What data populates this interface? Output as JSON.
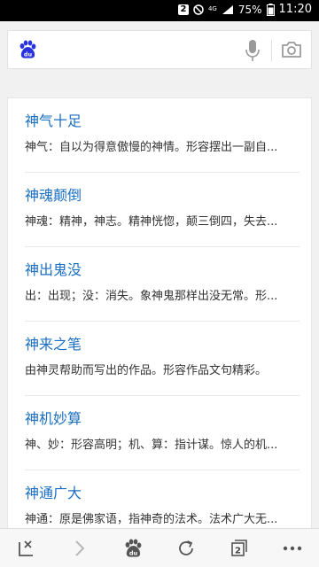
{
  "status_bar": {
    "badge": "2",
    "network": "4G",
    "battery": "75%",
    "time": "11:20"
  },
  "search": {
    "logo_text": "du",
    "value": "",
    "placeholder": ""
  },
  "results": [
    {
      "title": "神气十足",
      "desc": "神气：自以为得意傲慢的神情。形容摆出一副自..."
    },
    {
      "title": "神魂颠倒",
      "desc": "神魂：精神，神志。精神恍惚，颠三倒四，失去..."
    },
    {
      "title": "神出鬼没",
      "desc": "出：出现；没：消失。象神鬼那样出没无常。形..."
    },
    {
      "title": "神来之笔",
      "desc": "由神灵帮助而写出的作品。形容作品文句精彩。"
    },
    {
      "title": "神机妙算",
      "desc": "神、妙：形容高明；机、算：指计谋。惊人的机..."
    },
    {
      "title": "神通广大",
      "desc": "神通：原是佛家语，指神奇的法术。法术广大无..."
    }
  ],
  "toolbar": {
    "tab_count": "2",
    "logo_text": "du"
  },
  "colors": {
    "link": "#1a6fc2",
    "baidu_blue": "#2932e1",
    "icon_gray": "#555555"
  }
}
